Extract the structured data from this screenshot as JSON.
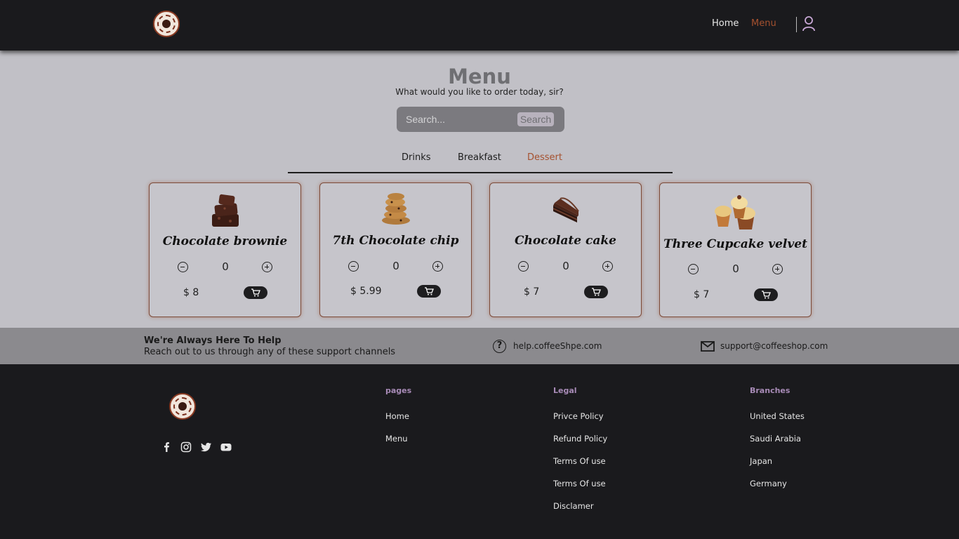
{
  "header": {
    "nav": [
      {
        "label": "Home",
        "active": false
      },
      {
        "label": "Menu",
        "active": true
      }
    ],
    "accent_color": "#a5512f"
  },
  "main": {
    "title": "Menu",
    "subtitle": "What would you like to order today, sir?",
    "search": {
      "placeholder": "Search...",
      "value": "",
      "button_label": "Search"
    },
    "tabs": [
      {
        "label": "Drinks",
        "active": false
      },
      {
        "label": "Breakfast",
        "active": false
      },
      {
        "label": "Dessert",
        "active": true
      }
    ],
    "products": [
      {
        "name": "Chocolate brownie",
        "quantity": "0",
        "price": "$ 8",
        "icon": "brownie-image"
      },
      {
        "name": "7th Chocolate chip",
        "quantity": "0",
        "price": "$ 5.99",
        "icon": "cookies-image"
      },
      {
        "name": "Chocolate cake",
        "quantity": "0",
        "price": "$ 7",
        "icon": "cake-slice-image"
      },
      {
        "name": "Three Cupcake velvet",
        "quantity": "0",
        "price": "$ 7",
        "icon": "cupcakes-image"
      }
    ]
  },
  "support": {
    "title": "We're Always Here To Help",
    "text": "Reach out to us through any of these support channels",
    "help_link": "help.coffeeShpe.com",
    "email": "support@coffeeshop.com"
  },
  "footer": {
    "social": [
      "facebook-icon",
      "instagram-icon",
      "twitter-icon",
      "youtube-icon"
    ],
    "columns": [
      {
        "heading": "pages",
        "links": [
          "Home",
          "Menu"
        ]
      },
      {
        "heading": "Legal",
        "links": [
          "Privce Policy",
          "Refund Policy",
          "Terms Of use",
          "Terms Of use",
          "Disclamer"
        ]
      },
      {
        "heading": "Branches",
        "links": [
          "United States",
          "Saudi Arabia",
          "Japan",
          "Germany"
        ]
      }
    ],
    "heading_color": "#a88bb7"
  }
}
